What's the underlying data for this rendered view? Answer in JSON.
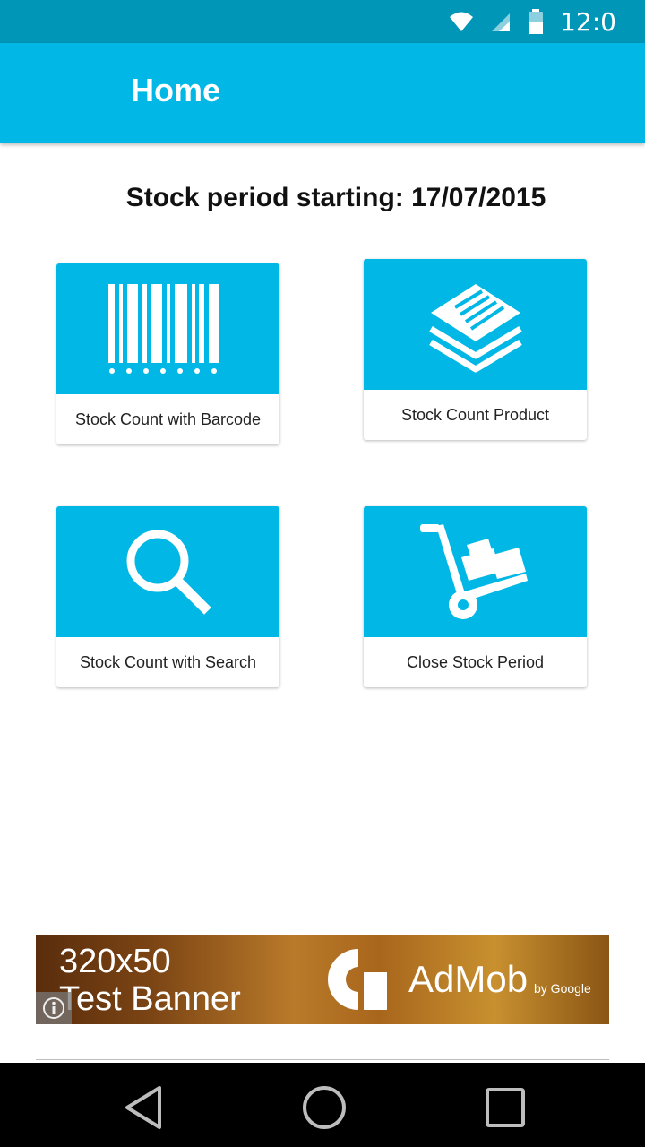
{
  "status": {
    "time": "12:0"
  },
  "app_bar": {
    "title": "Home"
  },
  "period": {
    "text": "Stock period starting: 17/07/2015"
  },
  "tiles": [
    {
      "label": "Stock Count with Barcode",
      "icon": "barcode-icon"
    },
    {
      "label": "Stock Count Product",
      "icon": "layers-icon"
    },
    {
      "label": "Stock Count with Search",
      "icon": "search-icon"
    },
    {
      "label": "Close Stock Period",
      "icon": "hand-truck-icon"
    }
  ],
  "ad": {
    "size": "320x50",
    "name": "Test Banner",
    "brand": "AdMob",
    "by": "by Google"
  },
  "colors": {
    "accent": "#00b7e6",
    "status_bar": "#0096b8",
    "nav_bar": "#000000"
  }
}
